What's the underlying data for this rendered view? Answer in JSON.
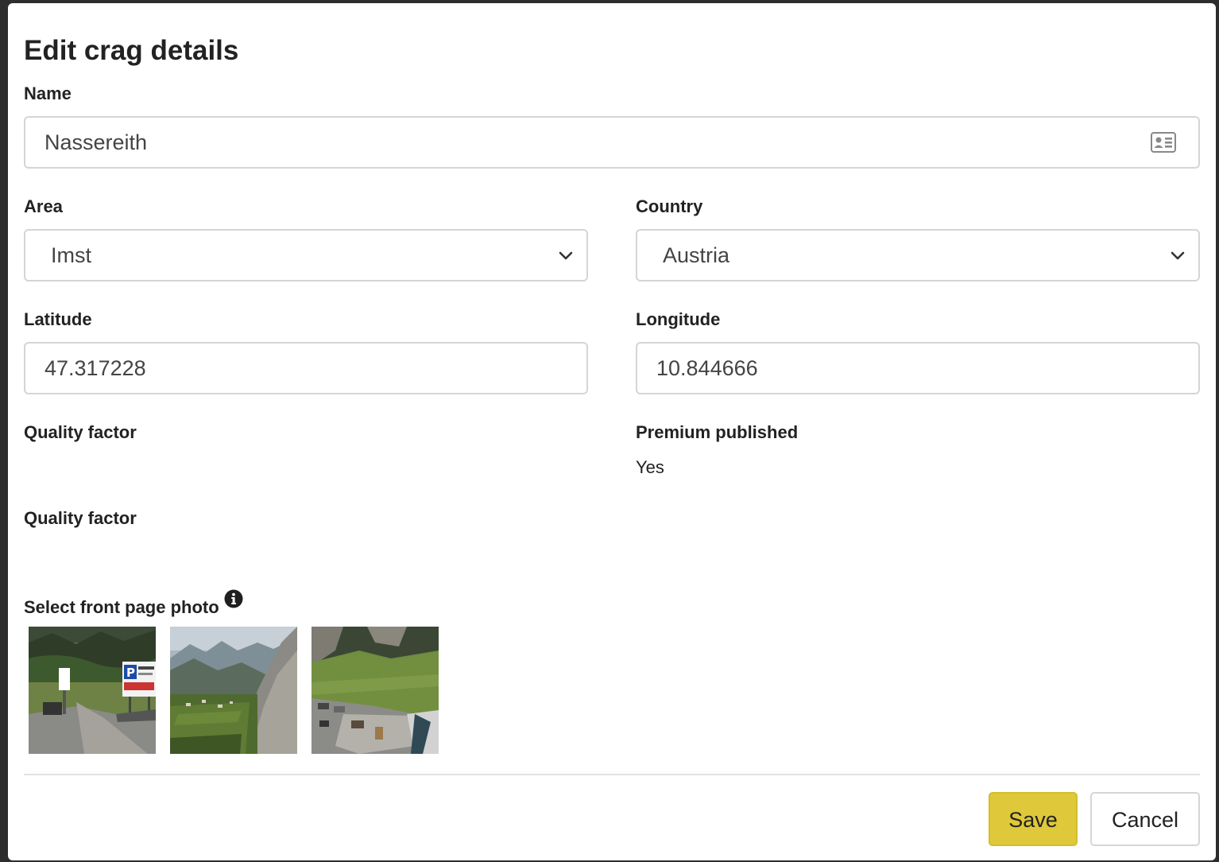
{
  "modal": {
    "title": "Edit crag details"
  },
  "form": {
    "name": {
      "label": "Name",
      "value": "Nassereith"
    },
    "area": {
      "label": "Area",
      "value": "Imst"
    },
    "country": {
      "label": "Country",
      "value": "Austria"
    },
    "latitude": {
      "label": "Latitude",
      "value": "47.317228"
    },
    "longitude": {
      "label": "Longitude",
      "value": "10.844666"
    },
    "quality_factor_1": {
      "label": "Quality factor"
    },
    "premium_published": {
      "label": "Premium published",
      "value": "Yes"
    },
    "quality_factor_2": {
      "label": "Quality factor"
    },
    "front_photo": {
      "label": "Select front page photo",
      "photos": [
        "parking-photo",
        "valley-photo",
        "parking-lot-photo"
      ]
    }
  },
  "footer": {
    "save_label": "Save",
    "cancel_label": "Cancel"
  },
  "colors": {
    "save_button": "#dfc83a",
    "border": "#d5d5d5",
    "text": "#222222"
  }
}
